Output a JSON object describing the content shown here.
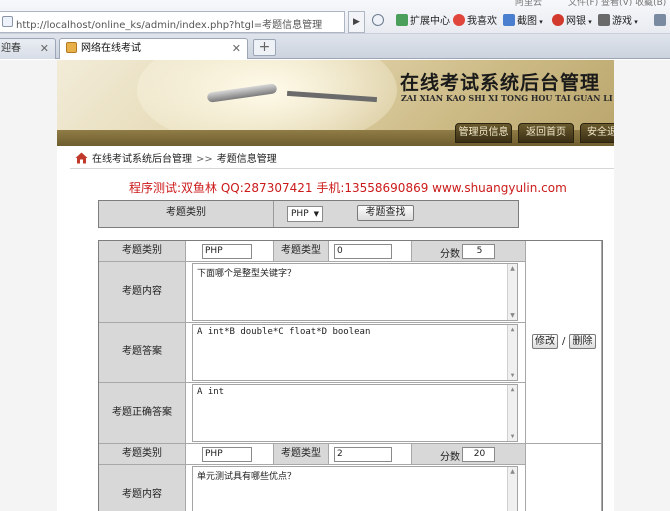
{
  "browser": {
    "url": "http://localhost/online_ks/admin/index.php?htgl=考题信息管理",
    "toolbar": {
      "extensions": "扩展中心",
      "favorites": "我喜欢",
      "screenshot": "截图",
      "netbank": "网银",
      "games": "游戏"
    },
    "top_cut": {
      "left": "阿里云",
      "right": "文件(F)  查看(V)  收藏(B)"
    },
    "tabs": [
      {
        "label": "迎春"
      },
      {
        "label": "网络在线考试"
      }
    ],
    "new_tab": "+"
  },
  "banner": {
    "title_cn": "在线考试系统后台管理",
    "title_en": "ZAI XIAN KAO SHI XI TONG HOU TAI GUAN LI",
    "nav": [
      {
        "label": "管理员信息"
      },
      {
        "label": "返回首页"
      },
      {
        "label": "安全退出"
      }
    ]
  },
  "breadcrumb": {
    "home": "在线考试系统后台管理",
    "separator": ">>",
    "current": "考题信息管理"
  },
  "tester_line": "程序测试:双鱼林 QQ:287307421 手机:13558690869 www.shuangyulin.com",
  "search": {
    "label": "考题类别",
    "category_value": "PHP",
    "button": "考题查找"
  },
  "labels": {
    "category": "考题类别",
    "type": "考题类型",
    "score": "分数",
    "content": "考题内容",
    "answer": "考题答案",
    "correct": "考题正确答案",
    "edit": "修改",
    "delete": "删除",
    "slash": "/"
  },
  "questions": [
    {
      "category": "PHP",
      "type": "0",
      "score": "5",
      "content": "下面哪个是整型关键字？",
      "answer": "A int*B double*C float*D boolean",
      "correct": "A int"
    },
    {
      "category": "PHP",
      "type": "2",
      "score": "20",
      "content": "单元测试具有哪些优点？"
    }
  ],
  "colors": {
    "tester_text": "#cc1a1a",
    "label_cell": "#d8d8d8",
    "nav_button": "#4a3d1c"
  }
}
